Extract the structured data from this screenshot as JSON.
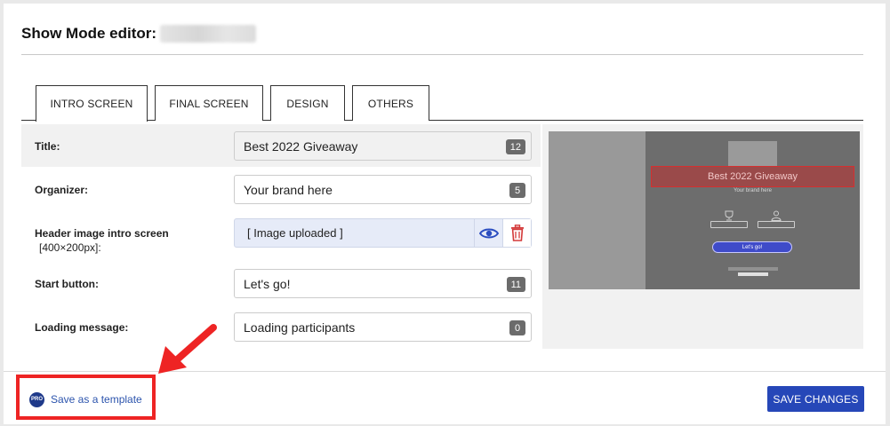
{
  "header": {
    "title": "Show Mode editor:"
  },
  "tabs": [
    {
      "label": "INTRO SCREEN",
      "active": true
    },
    {
      "label": "FINAL SCREEN",
      "active": false
    },
    {
      "label": "DESIGN",
      "active": false
    },
    {
      "label": "OTHERS",
      "active": false
    }
  ],
  "form": {
    "title": {
      "label": "Title:",
      "value": "Best 2022 Giveaway",
      "count": "12"
    },
    "organizer": {
      "label": "Organizer:",
      "value": "Your brand here",
      "count": "5"
    },
    "header_image": {
      "label": "Header image intro screen",
      "sublabel": "[400×200px]:",
      "value": "[ Image uploaded ]"
    },
    "start_button": {
      "label": "Start button:",
      "value": "Let's go!",
      "count": "11"
    },
    "loading": {
      "label": "Loading message:",
      "value": "Loading participants",
      "count": "0"
    }
  },
  "preview": {
    "title": "Best 2022 Giveaway",
    "organizer": "Your brand here",
    "box_left": "participants",
    "box_right": "winner",
    "button": "Let's go!"
  },
  "footer": {
    "pro_badge": "PRO",
    "save_template": "Save as a template",
    "save_changes": "SAVE CHANGES"
  },
  "colors": {
    "accent": "#2647b8",
    "link": "#2c54ad",
    "highlight": "#ee2424"
  }
}
